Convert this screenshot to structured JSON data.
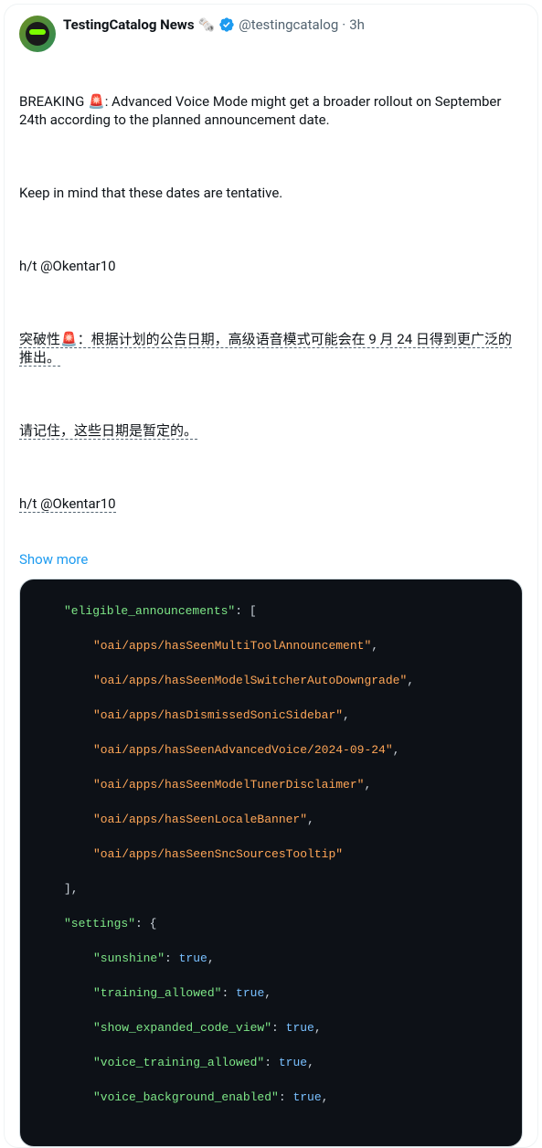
{
  "tweet": {
    "author": {
      "display_name": "TestingCatalog News",
      "emoji": "🗞️",
      "handle": "@testingcatalog",
      "time": "3h",
      "separator": "·"
    },
    "body": {
      "p1": "BREAKING 🚨: Advanced Voice Mode might get a broader rollout on September 24th according to the planned announcement date.",
      "p2": "Keep in mind that these dates are tentative.",
      "p3": "h/t @Okentar10",
      "t1": "突破性🚨：根据计划的公告日期，高级语音模式可能会在 9 月 24 日得到更广泛的推出。",
      "t2": "请记住，这些日期是暂定的。",
      "t3": "h/t @Okentar10"
    },
    "show_more": "Show more",
    "code": {
      "key_eligible": "\"eligible_announcements\"",
      "arr": [
        "\"oai/apps/hasSeenMultiToolAnnouncement\"",
        "\"oai/apps/hasSeenModelSwitcherAutoDowngrade\"",
        "\"oai/apps/hasDismissedSonicSidebar\"",
        "\"oai/apps/hasSeenAdvancedVoice/2024-09-24\"",
        "\"oai/apps/hasSeenModelTunerDisclaimer\"",
        "\"oai/apps/hasSeenLocaleBanner\"",
        "\"oai/apps/hasSeenSncSourcesTooltip\""
      ],
      "key_settings": "\"settings\"",
      "settings": [
        {
          "k": "\"sunshine\"",
          "v": "true"
        },
        {
          "k": "\"training_allowed\"",
          "v": "true"
        },
        {
          "k": "\"show_expanded_code_view\"",
          "v": "true"
        },
        {
          "k": "\"voice_training_allowed\"",
          "v": "true"
        },
        {
          "k": "\"voice_background_enabled\"",
          "v": "true"
        }
      ]
    }
  }
}
